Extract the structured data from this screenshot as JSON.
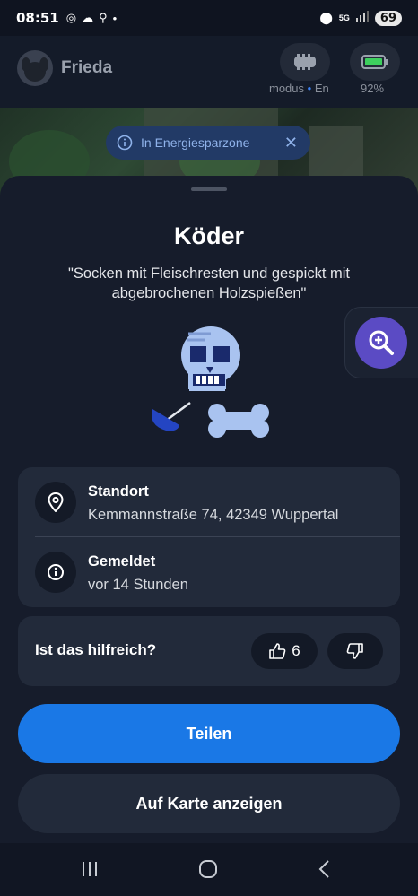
{
  "status_bar": {
    "time": "08:51",
    "battery_level": "69",
    "network": "5G"
  },
  "header": {
    "pet_name": "Frieda",
    "mode_label": "modus",
    "mode_label_suffix": "En",
    "battery_label": "92%",
    "battery_level": 0.92,
    "accent": "#3b82f6"
  },
  "map_banner": {
    "label": "In Energiesparzone"
  },
  "sheet": {
    "title": "Köder",
    "quote_line1": "\"Socken mit Fleischresten und gespickt mit",
    "quote_line2": "abgebrochenen Holzspießen\"",
    "details": [
      {
        "icon": "location-pin-icon",
        "label": "Standort",
        "value": "Kemmannstraße 74, 42349 Wuppertal"
      },
      {
        "icon": "info-icon",
        "label": "Gemeldet",
        "value": "vor 14 Stunden"
      }
    ],
    "helpful_question": "Ist das hilfreich?",
    "upvotes": "6",
    "share_label": "Teilen",
    "show_on_map_label": "Auf Karte anzeigen",
    "share_color": "#1a78e6",
    "zoom_color": "#5b4bc4"
  },
  "nav": {
    "items": [
      "recents-icon",
      "home-icon",
      "back-icon"
    ]
  }
}
